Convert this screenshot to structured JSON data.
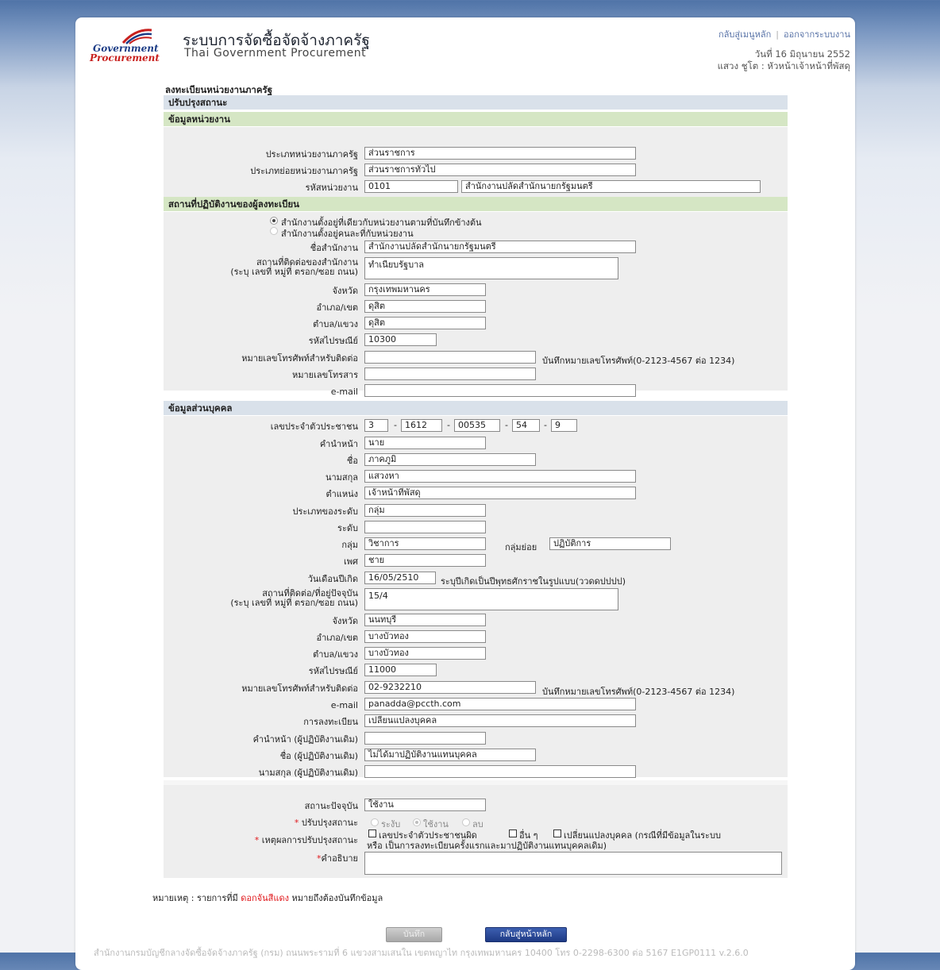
{
  "header": {
    "logo_line1": "Government",
    "logo_line2": "Procurement",
    "title_th": "ระบบการจัดซื้อจัดจ้างภาครัฐ",
    "title_en": "Thai Government Procurement",
    "link_menu": "กลับสู่เมนูหลัก",
    "link_sep": "|",
    "link_logout": "ออกจากระบบงาน",
    "date": "วันที่ 16 มิถุนายน 2552",
    "user": "แสวง ชูโต : หัวหน้าเจ้าหน้าที่พัสดุ"
  },
  "page_title": "ลงทะเบียนหน่วยงานภาครัฐ",
  "band_update": "ปรับปรุงสถานะ",
  "section_agency": {
    "title": "ข้อมูลหน่วยงาน",
    "type_label": "ประเภทหน่วยงานภาครัฐ",
    "type_value": "ส่วนราชการ",
    "subtype_label": "ประเภทย่อยหน่วยงานภาครัฐ",
    "subtype_value": "ส่วนราชการทั่วไป",
    "code_label": "รหัสหน่วยงาน",
    "code_value": "0101",
    "code_name": "สำนักงานปลัดสำนักนายกรัฐมนตรี"
  },
  "section_office": {
    "title": "สถานที่ปฏิบัติงานของผู้ลงทะเบียน",
    "radio1": "สำนักงานตั้งอยู่ที่เดียวกับหน่วยงานตามที่บันทึกข้างต้น",
    "radio2": "สำนักงานตั้งอยู่คนละที่กับหน่วยงาน",
    "office_name_label": "ชื่อสำนักงาน",
    "office_name": "สำนักงานปลัดสำนักนายกรัฐมนตรี",
    "address_label1": "สถานที่ติดต่อของสำนักงาน",
    "address_label2": "(ระบุ เลขที่ หมู่ที่ ตรอก/ซอย ถนน)",
    "address": "ทำเนียบรัฐบาล",
    "province_label": "จังหวัด",
    "province": "กรุงเทพมหานคร",
    "district_label": "อำเภอ/เขต",
    "district": "ดุสิต",
    "subdistrict_label": "ตำบล/แขวง",
    "subdistrict": "ดุสิต",
    "postcode_label": "รหัสไปรษณีย์",
    "postcode": "10300",
    "phone_label": "หมายเลขโทรศัพท์สำหรับติดต่อ",
    "phone": "",
    "phone_hint": "บันทึกหมายเลขโทรศัพท์(0-2123-4567 ต่อ 1234)",
    "fax_label": "หมายเลขโทรสาร",
    "fax": "",
    "email_label": "e-mail",
    "email": ""
  },
  "section_person": {
    "title": "ข้อมูลส่วนบุคคล",
    "id_label": "เลขประจำตัวประชาชน",
    "id_parts": [
      "3",
      "1612",
      "00535",
      "54",
      "9"
    ],
    "dash": "-",
    "prefix_label": "คำนำหน้า",
    "prefix": "นาย",
    "firstname_label": "ชื่อ",
    "firstname": "ภาคภูมิ",
    "lastname_label": "นามสกุล",
    "lastname": "แสวงหา",
    "position_label": "ตำแหน่ง",
    "position": "เจ้าหน้าที่พัสดุ",
    "level_type_label": "ประเภทของระดับ",
    "level_type": "กลุ่ม",
    "level_label": "ระดับ",
    "level": "",
    "group_label": "กลุ่ม",
    "group": "วิชาการ",
    "subgroup_label": "กลุ่มย่อย",
    "subgroup": "ปฏิบัติการ",
    "gender_label": "เพศ",
    "gender": "ชาย",
    "dob_label": "วันเดือนปีเกิด",
    "dob": "16/05/2510",
    "dob_hint": "ระบุปีเกิดเป็นปีพุทธศักราชในรูปแบบ(ววดดปปปป)",
    "address_label1": "สถานที่ติดต่อ/ที่อยู่ปัจจุบัน",
    "address_label2": "(ระบุ เลขที่ หมู่ที่ ตรอก/ซอย ถนน)",
    "address": "15/4",
    "province_label": "จังหวัด",
    "province": "นนทบุรี",
    "district_label": "อำเภอ/เขต",
    "district": "บางบัวทอง",
    "subdistrict_label": "ตำบล/แขวง",
    "subdistrict": "บางบัวทอง",
    "postcode_label": "รหัสไปรษณีย์",
    "postcode": "11000",
    "phone_label": "หมายเลขโทรศัพท์สำหรับติดต่อ",
    "phone": "02-9232210",
    "phone_hint": "บันทึกหมายเลขโทรศัพท์(0-2123-4567 ต่อ 1234)",
    "email_label": "e-mail",
    "email": "panadda@pccth.com",
    "reg_label": "การลงทะเบียน",
    "reg": "เปลี่ยนแปลงบุคคล",
    "old_prefix_label": "คำนำหน้า (ผู้ปฏิบัติงานเดิม)",
    "old_prefix": "",
    "old_name_label": "ชื่อ (ผู้ปฏิบัติงานเดิม)",
    "old_name": "ไม่ได้มาปฏิบัติงานแทนบุคคล",
    "old_lastname_label": "นามสกุล (ผู้ปฏิบัติงานเดิม)",
    "old_lastname": ""
  },
  "status": {
    "current_label": "สถานะปัจจุบัน",
    "current": "ใช้งาน",
    "req_mark": "*",
    "update_label": "ปรับปรุงสถานะ",
    "opt_suspend": "ระงับ",
    "opt_active": "ใช้งาน",
    "opt_delete": "ลบ",
    "reason_label": "เหตุผลการปรับปรุงสถานะ",
    "reason1": "เลขประจำตัวประชาชนผิด",
    "reason2": "อื่น ๆ",
    "reason3": "เปลี่ยนแปลงบุคคล (กรณีที่มีข้อมูลในระบบ",
    "reason3_line2": "หรือ เป็นการลงทะเบียนครั้งแรกและมาปฏิบัติงานแทนบุคคลเดิม)",
    "explain_label": "คำอธิบาย",
    "explain": ""
  },
  "note": {
    "prefix": "หมายเหตุ : รายการที่มี",
    "highlight": "ดอกจันสีแดง",
    "suffix": "หมายถึงต้องบันทึกข้อมูล"
  },
  "buttons": {
    "save": "บันทึก",
    "back": "กลับสู่หน้าหลัก"
  },
  "footer": "สำนักงานกรมบัญชีกลางจัดซื้อจัดจ้างภาครัฐ (กรม) ถนนพระรามที่ 6 แขวงสามเสนใน เขตพญาไท กรุงเทพมหานคร 10400 โทร 0-2298-6300 ต่อ 5167 E1GP0111 v.2.6.0",
  "colors": {
    "band_blue": "#d9e1ea",
    "band_green": "#d5e6c4",
    "required": "#e0191d",
    "button_primary": "#1e3a85"
  }
}
